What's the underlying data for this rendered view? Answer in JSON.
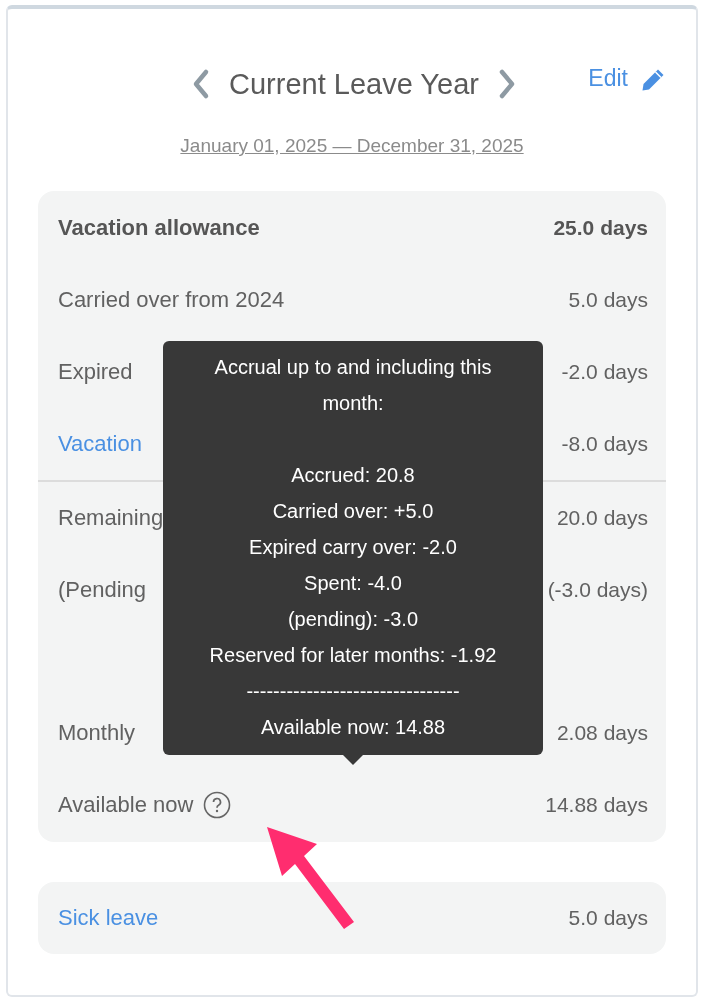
{
  "header": {
    "title": "Current Leave Year",
    "edit": "Edit",
    "period": "January 01, 2025 — December 31, 2025"
  },
  "allowance": [
    {
      "kind": "total",
      "label": "Vacation allowance",
      "value": "25.0 days"
    },
    {
      "kind": "plain",
      "label": "Carried over from 2024",
      "value": "5.0 days"
    },
    {
      "kind": "plain",
      "label": "Expired",
      "value": "-2.0 days"
    },
    {
      "kind": "link",
      "label": "Vacation",
      "value": "-8.0 days"
    }
  ],
  "balance": [
    [
      {
        "kind": "plain",
        "label": "Remaining",
        "value": "20.0 days"
      },
      {
        "kind": "plain",
        "label": "(Pending",
        "value": "(-3.0 days)"
      }
    ],
    [
      {
        "kind": "plain",
        "label": "Monthly",
        "value": "2.08 days"
      },
      {
        "kind": "help",
        "label": "Available now",
        "value": "14.88 days"
      }
    ]
  ],
  "tooltip": {
    "blocks": [
      [
        "Accrual up to and including this month:"
      ],
      [
        "Accrued: 20.8",
        "Carried over: +5.0",
        "Expired carry over: -2.0",
        "Spent: -4.0",
        "(pending): -3.0",
        "Reserved for later months: -1.92",
        "--------------------------------",
        "Available now: 14.88"
      ]
    ]
  },
  "sick_leave": {
    "kind": "link",
    "label": "Sick leave",
    "value": "5.0 days"
  }
}
